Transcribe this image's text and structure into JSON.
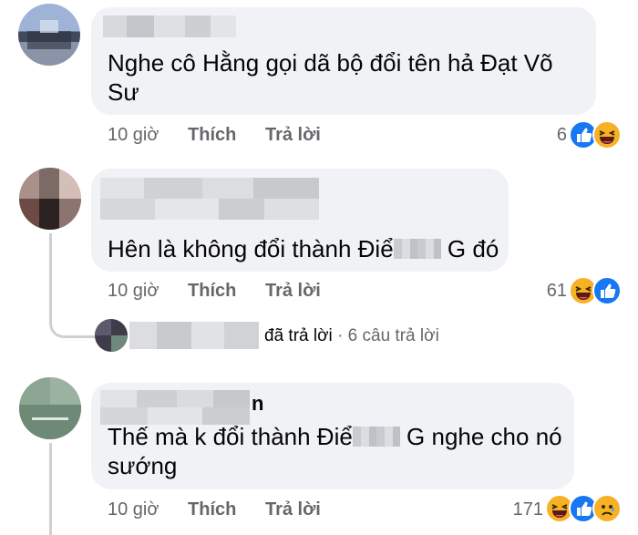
{
  "comments": [
    {
      "text": "Nghe cô Hằng gọi dã bộ đổi tên hả Đạt Võ Sư",
      "time": "10 giờ",
      "like_label": "Thích",
      "reply_label": "Trả lời",
      "reaction_count": "6",
      "reactions": [
        "like-icon",
        "haha-icon"
      ]
    },
    {
      "text_before": "Hên là không đổi thành Điể",
      "text_after": "G đó",
      "time": "10 giờ",
      "like_label": "Thích",
      "reply_label": "Trả lời",
      "reaction_count": "61",
      "reactions": [
        "haha-icon",
        "like-icon"
      ],
      "replies_summary": {
        "replied_text": "đã trả lời",
        "separator": "·",
        "replies_count": "6 câu trả lời"
      }
    },
    {
      "name_visible_suffix": "n",
      "text_before": "Thế mà k đổi thành Điể",
      "text_after": "G nghe cho nó sướng",
      "time": "10 giờ",
      "like_label": "Thích",
      "reply_label": "Trả lời",
      "reaction_count": "171",
      "reactions": [
        "haha-icon",
        "like-icon",
        "sad-icon"
      ]
    }
  ],
  "colors": {
    "bubble": "#f0f2f5",
    "meta_text": "#65676b",
    "like_blue": "#1877f2",
    "emoji_yellow": "#f7b125"
  }
}
